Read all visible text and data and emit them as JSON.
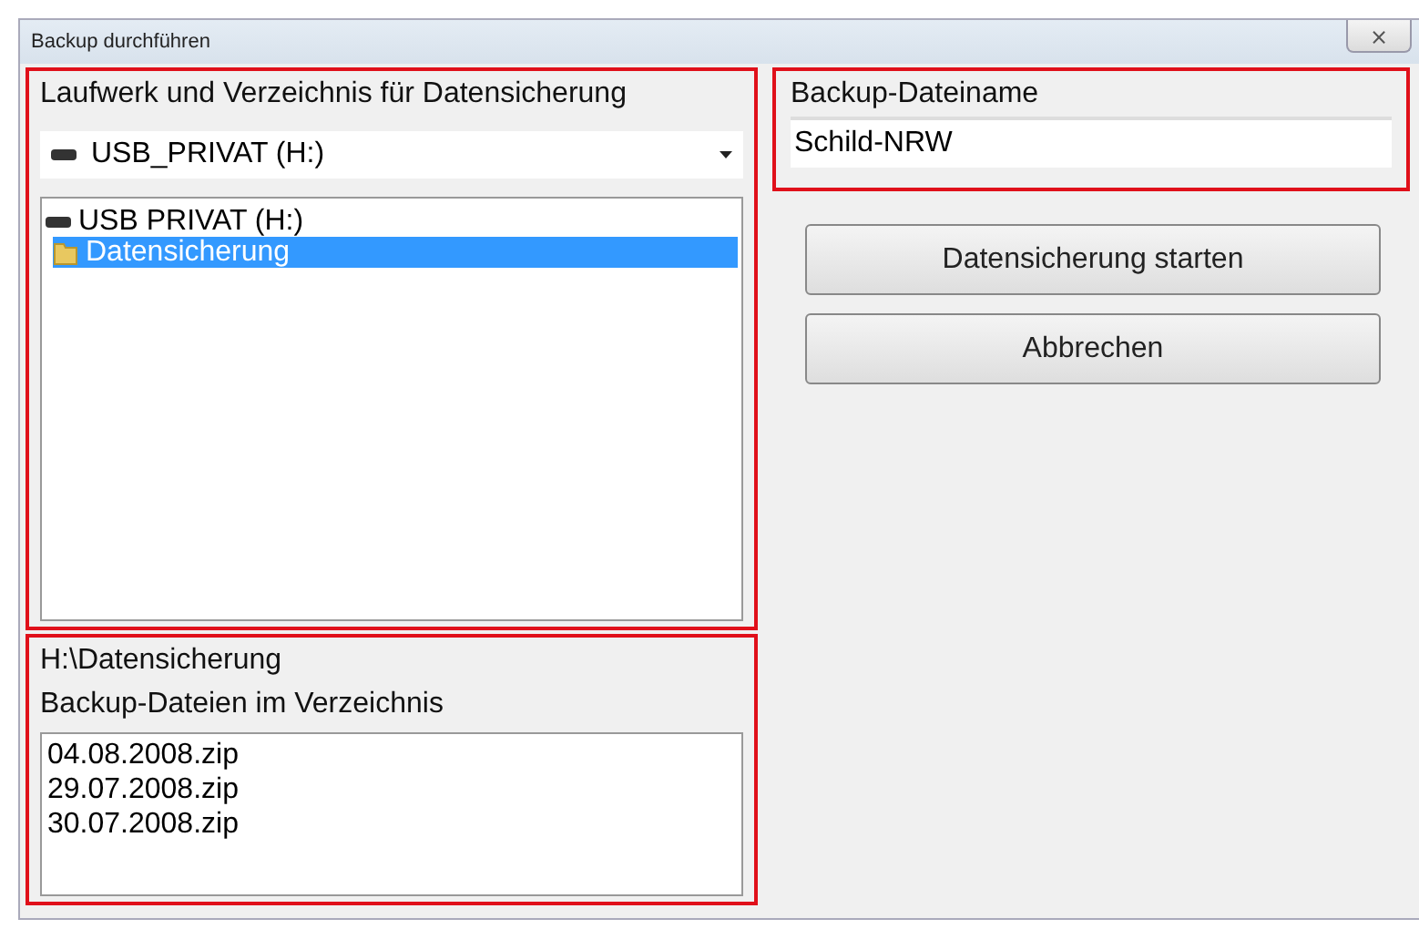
{
  "window": {
    "title": "Backup durchführen",
    "close": "⨯"
  },
  "location": {
    "heading": "Laufwerk und Verzeichnis für Datensicherung",
    "drive": "USB_PRIVAT (H:)",
    "tree": [
      {
        "label": "USB PRIVAT (H:)",
        "kind": "drive",
        "selected": false,
        "children": [
          {
            "label": "Datensicherung",
            "kind": "folder",
            "selected": true
          }
        ]
      }
    ]
  },
  "files": {
    "path": "H:\\Datensicherung",
    "heading": "Backup-Dateien im Verzeichnis",
    "items": [
      "04.08.2008.zip",
      "29.07.2008.zip",
      "30.07.2008.zip"
    ]
  },
  "filename": {
    "label": "Backup-Dateiname",
    "value": "Schild-NRW"
  },
  "buttons": [
    "Datensicherung starten",
    "Abbrechen"
  ]
}
